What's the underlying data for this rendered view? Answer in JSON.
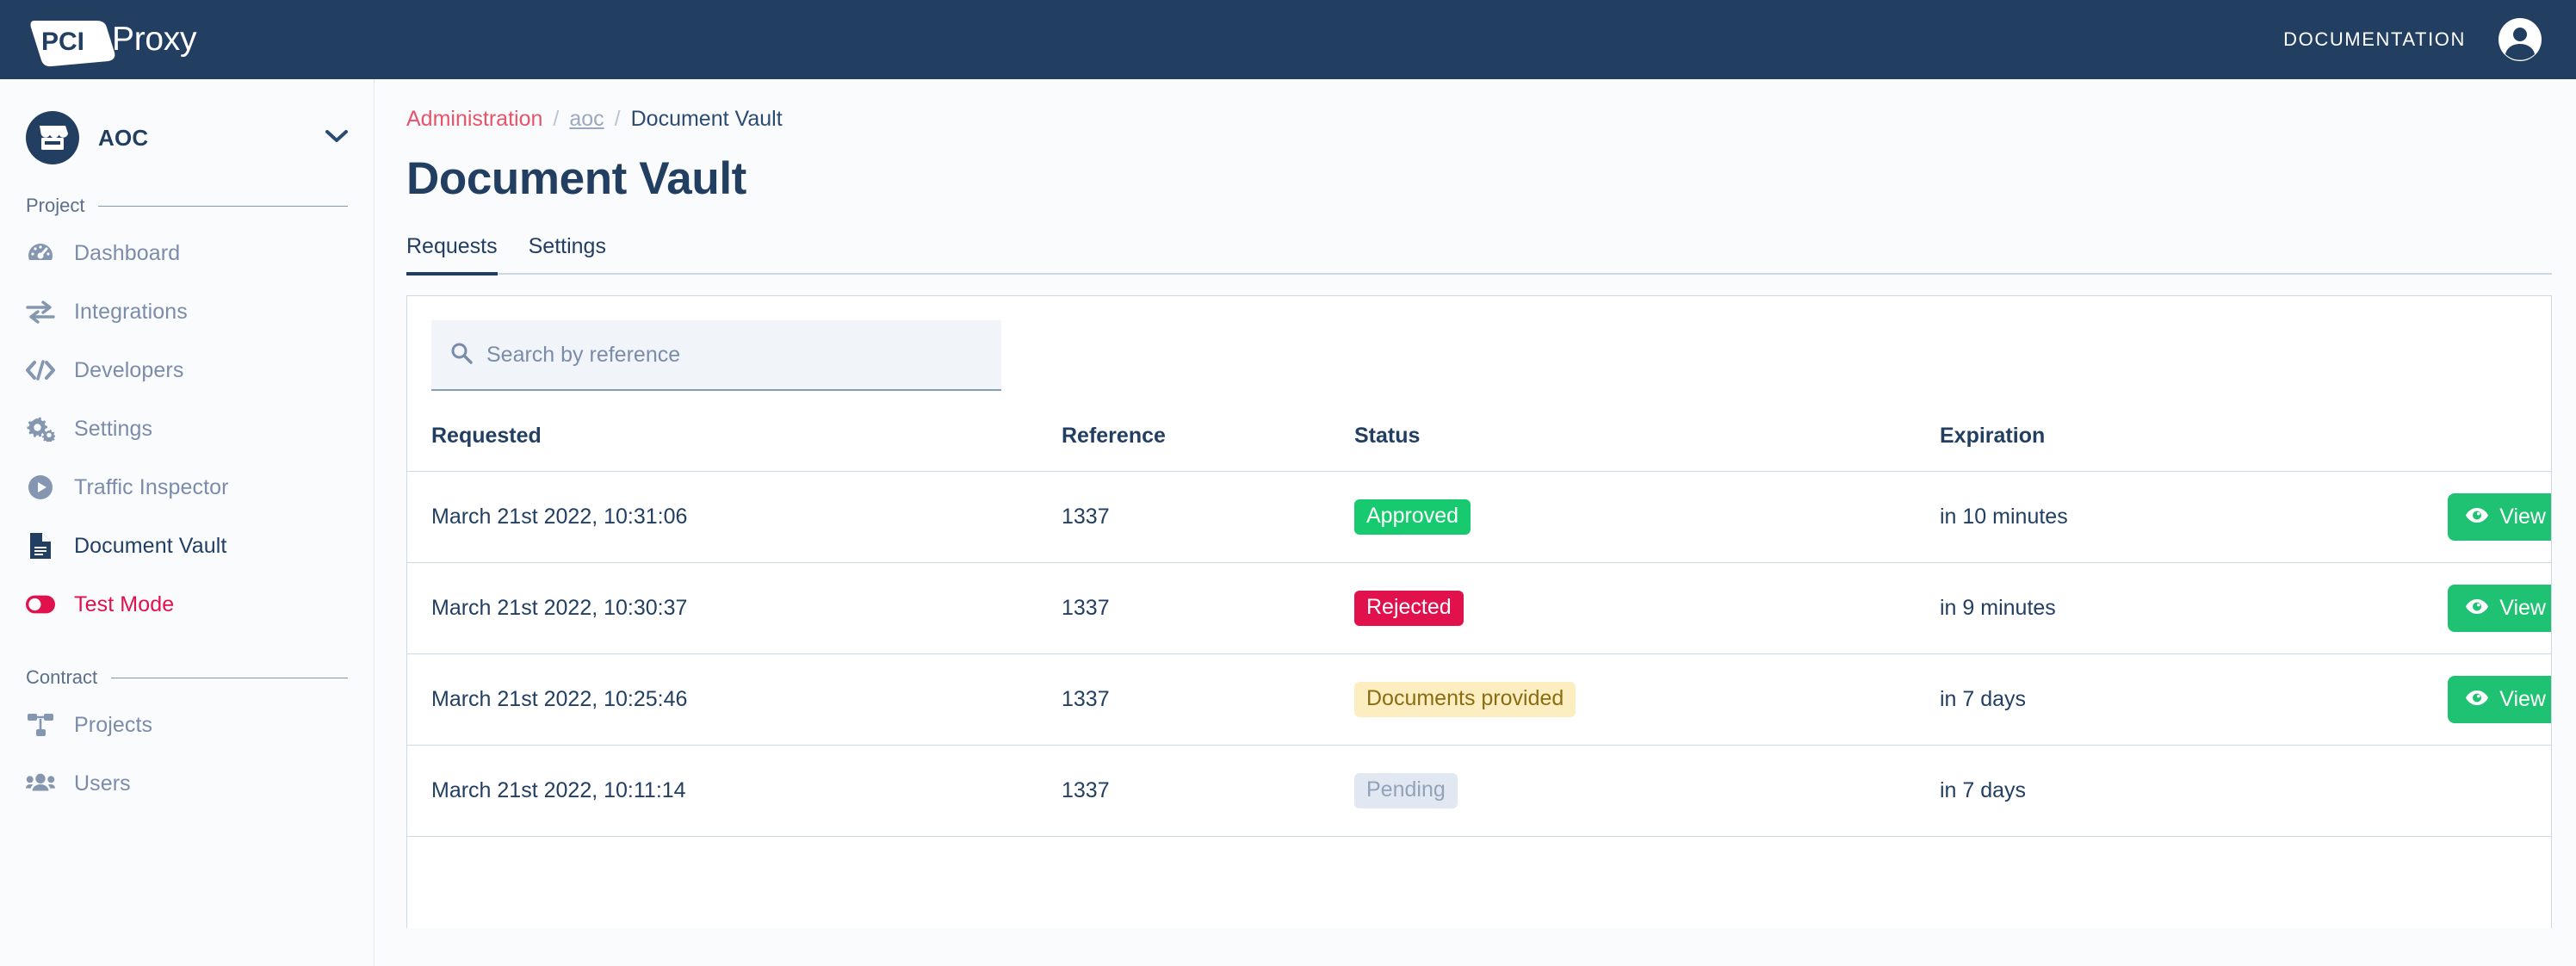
{
  "header": {
    "logo_mark": "PCI",
    "logo_word": "Proxy",
    "documentation_label": "DOCUMENTATION",
    "avatar_icon": "user-avatar-icon",
    "background_color": "#223f62"
  },
  "sidebar": {
    "project_selector": {
      "name": "AOC",
      "icon": "store-icon",
      "chevron_icon": "chevron-down-icon"
    },
    "sections": [
      {
        "label": "Project",
        "items": [
          {
            "label": "Dashboard",
            "icon": "dashboard-gauge-icon"
          },
          {
            "label": "Integrations",
            "icon": "exchange-arrows-icon"
          },
          {
            "label": "Developers",
            "icon": "code-brackets-icon"
          },
          {
            "label": "Settings",
            "icon": "gears-icon"
          },
          {
            "label": "Traffic Inspector",
            "icon": "play-circle-icon"
          },
          {
            "label": "Document Vault",
            "icon": "document-icon"
          },
          {
            "label": "Test Mode",
            "icon": "toggle-off-icon"
          }
        ]
      },
      {
        "label": "Contract",
        "items": [
          {
            "label": "Projects",
            "icon": "sitemap-icon"
          },
          {
            "label": "Users",
            "icon": "users-icon"
          }
        ]
      }
    ],
    "active_item": "Document Vault",
    "test_mode_color": "#e0114d"
  },
  "main": {
    "breadcrumb": {
      "root": "Administration",
      "middle": "aoc",
      "current": "Document Vault",
      "separator": "/"
    },
    "page_title": "Document Vault",
    "tabs": [
      {
        "label": "Requests",
        "active": true
      },
      {
        "label": "Settings",
        "active": false
      }
    ],
    "search": {
      "placeholder": "Search by reference",
      "value": "",
      "icon": "search-icon"
    },
    "table": {
      "columns": [
        "Requested",
        "Reference",
        "Status",
        "Expiration",
        ""
      ],
      "rows": [
        {
          "requested": "March 21st 2022, 10:31:06",
          "reference": "1337",
          "status": "Approved",
          "status_kind": "approved",
          "expiration": "in 10 minutes",
          "action": "View"
        },
        {
          "requested": "March 21st 2022, 10:30:37",
          "reference": "1337",
          "status": "Rejected",
          "status_kind": "rejected",
          "expiration": "in 9 minutes",
          "action": "View"
        },
        {
          "requested": "March 21st 2022, 10:25:46",
          "reference": "1337",
          "status": "Documents provided",
          "status_kind": "documents",
          "expiration": "in 7 days",
          "action": "View"
        },
        {
          "requested": "March 21st 2022, 10:11:14",
          "reference": "1337",
          "status": "Pending",
          "status_kind": "pending",
          "expiration": "in 7 days",
          "action": ""
        },
        {
          "requested": "",
          "reference": "",
          "status": "",
          "status_kind": "",
          "expiration": "",
          "action": ""
        }
      ]
    },
    "action_icon": "eye-icon"
  },
  "colors": {
    "brand_navy": "#223f62",
    "accent_red": "#e8536a",
    "status_green": "#17ca6f",
    "status_crimson": "#e0114d",
    "status_yellow_bg": "#fceec0",
    "status_yellow_text": "#8a6d12",
    "status_pending_bg": "#e2e8f2",
    "status_pending_text": "#92a2bb",
    "button_green": "#1fc172"
  }
}
